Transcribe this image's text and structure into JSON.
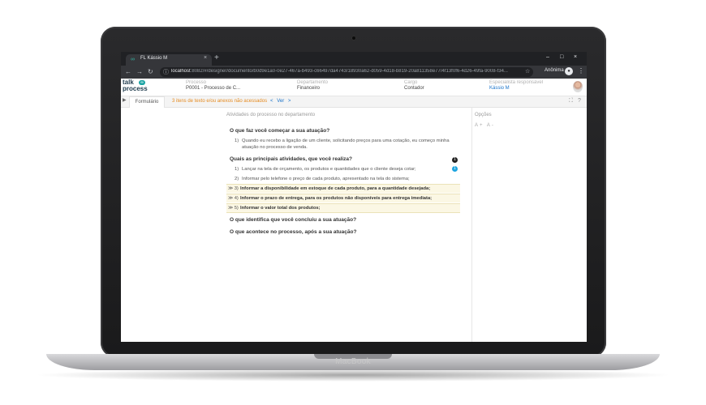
{
  "browser": {
    "tab_title": "FL Kássio M",
    "tab_close": "×",
    "new_tab": "+",
    "url_host": "localhost",
    "url_rest": ":8082/#/designer/documento/b0d9e1a0-0e27-467a-b493-c66497da4743/18930a62-d059-4d18-b819-20a811358e77/4f13f0f6-4d26-49fa-9008-f34...",
    "profile_label": "Anônima",
    "win_minimize": "–",
    "win_restore": "□",
    "win_close": "×"
  },
  "header": {
    "logo_top": "talk",
    "logo_bottom": "process",
    "fields": [
      {
        "label": "Processo",
        "value": "P0001 - Processo de C..."
      },
      {
        "label": "Departamento",
        "value": "Financeiro"
      },
      {
        "label": "Cargo",
        "value": "Contador"
      },
      {
        "label": "Especialista responsável",
        "value": "Kássio M"
      }
    ]
  },
  "formbar": {
    "tab_label": "Formulário",
    "notice": "3 itens de texto e/ou anexos não acessados",
    "prev": "<",
    "ver_label": "Ver",
    "next": ">"
  },
  "main": {
    "section_title": "Atividades do processo no departamento",
    "q1": "O que faz você começar a sua atuação?",
    "q1_answers": [
      {
        "num": "1)",
        "text": "Quando eu recebo a ligação de um cliente, solicitando preços para uma cotação, eu começo minha atuação no processo de venda."
      }
    ],
    "q2": "Quais as principais atividades, que você realiza?",
    "q2_answers": [
      {
        "num": "1)",
        "text": "Lançar na tela de orçamento, os produtos e quantidades que o cliente deseja cotar;"
      },
      {
        "num": "2)",
        "text": "Informar pelo telefone o preço de cada produto, apresentado na tela do sistema;"
      }
    ],
    "q2_highlighted": [
      {
        "num": "3)",
        "text": "Informar a disponibilidade em estoque de cada produto, para a quantidade desejada;"
      },
      {
        "num": "4)",
        "text": "Informar o prazo de entrega, para os produtos não disponíveis para entrega imediata;"
      },
      {
        "num": "5)",
        "text": "Informar o valor total dos produtos;"
      }
    ],
    "badge_1": "1",
    "badge_2": "1",
    "q3": "O que identifica que você concluiu a sua atuação?",
    "q4": "O que acontece no processo, após a sua atuação?"
  },
  "options": {
    "title": "Opções",
    "font_controls": "A+ A-"
  },
  "device": {
    "brand": "MacBook"
  }
}
